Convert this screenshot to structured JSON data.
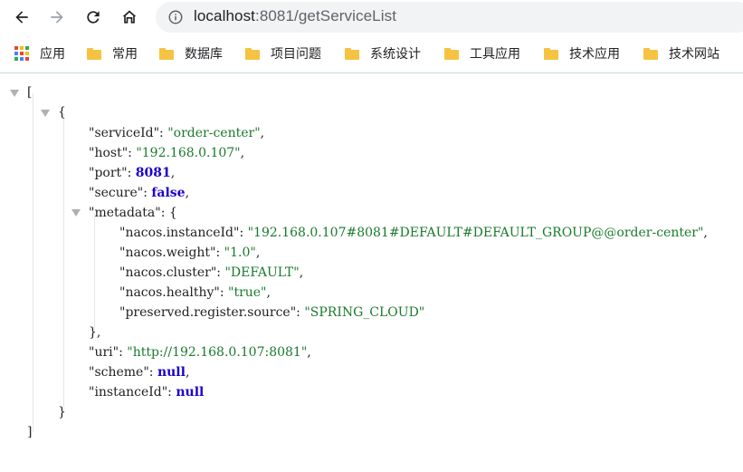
{
  "browser": {
    "url_host": "localhost",
    "url_rest": ":8081/getServiceList",
    "icons": {
      "back": "arrow-left-icon",
      "forward": "arrow-right-icon",
      "reload": "reload-icon",
      "home": "home-icon",
      "info": "info-icon"
    }
  },
  "bookmarks": {
    "apps_label": "应用",
    "items": [
      "常用",
      "数据库",
      "项目问题",
      "系统设计",
      "工具应用",
      "技术应用",
      "技术网站"
    ]
  },
  "json": {
    "open_bracket": "[",
    "close_bracket": "]",
    "open_brace": "{",
    "close_brace": "}",
    "meta_close": "},",
    "serviceId": {
      "key": "\"serviceId\"",
      "value": "\"order-center\""
    },
    "host": {
      "key": "\"host\"",
      "value": "\"192.168.0.107\""
    },
    "port": {
      "key": "\"port\"",
      "value": "8081"
    },
    "secure": {
      "key": "\"secure\"",
      "value": "false"
    },
    "metadata_key": "\"metadata\"",
    "metadata": [
      {
        "key": "\"nacos.instanceId\"",
        "value": "\"192.168.0.107#8081#DEFAULT#DEFAULT_GROUP@@order-center\""
      },
      {
        "key": "\"nacos.weight\"",
        "value": "\"1.0\""
      },
      {
        "key": "\"nacos.cluster\"",
        "value": "\"DEFAULT\""
      },
      {
        "key": "\"nacos.healthy\"",
        "value": "\"true\""
      },
      {
        "key": "\"preserved.register.source\"",
        "value": "\"SPRING_CLOUD\""
      }
    ],
    "uri": {
      "key": "\"uri\"",
      "value": "\"http://192.168.0.107:8081\""
    },
    "scheme": {
      "key": "\"scheme\"",
      "value": "null"
    },
    "instanceId": {
      "key": "\"instanceId\"",
      "value": "null"
    }
  },
  "colors": {
    "string": "#1a7a2c",
    "keyword": "#1c00cf",
    "folder": "#f5c342"
  }
}
